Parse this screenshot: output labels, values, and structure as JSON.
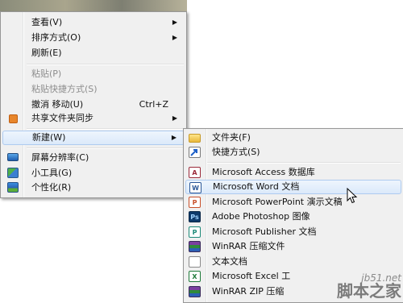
{
  "context_menu": {
    "items": [
      {
        "label": "查看(V)",
        "arrow": "▶"
      },
      {
        "label": "排序方式(O)",
        "arrow": "▶"
      },
      {
        "label": "刷新(E)"
      },
      {
        "label": "粘贴(P)"
      },
      {
        "label": "粘贴快捷方式(S)"
      },
      {
        "label": "撤消 移动(U)",
        "shortcut": "Ctrl+Z"
      },
      {
        "label": "共享文件夹同步",
        "arrow": "▶"
      },
      {
        "label": "新建(W)",
        "arrow": "▶"
      },
      {
        "label": "屏幕分辨率(C)"
      },
      {
        "label": "小工具(G)"
      },
      {
        "label": "个性化(R)"
      }
    ]
  },
  "new_submenu": {
    "items": [
      {
        "label": "文件夹(F)"
      },
      {
        "label": "快捷方式(S)"
      },
      {
        "label": "Microsoft Access 数据库"
      },
      {
        "label": "Microsoft Word 文档"
      },
      {
        "label": "Microsoft PowerPoint 演示文稿"
      },
      {
        "label": "Adobe Photoshop 图像"
      },
      {
        "label": "Microsoft Publisher 文档"
      },
      {
        "label": "WinRAR 压缩文件"
      },
      {
        "label": "文本文档"
      },
      {
        "label": "Microsoft Excel 工"
      },
      {
        "label": "WinRAR ZIP 压缩"
      }
    ]
  },
  "watermark": {
    "url": "jb51.net",
    "name": "脚本之家"
  },
  "colors": {
    "highlight": "#dbe9fa",
    "highlight_border": "#aecbf0",
    "menu_bg": "#f0f0f0"
  }
}
